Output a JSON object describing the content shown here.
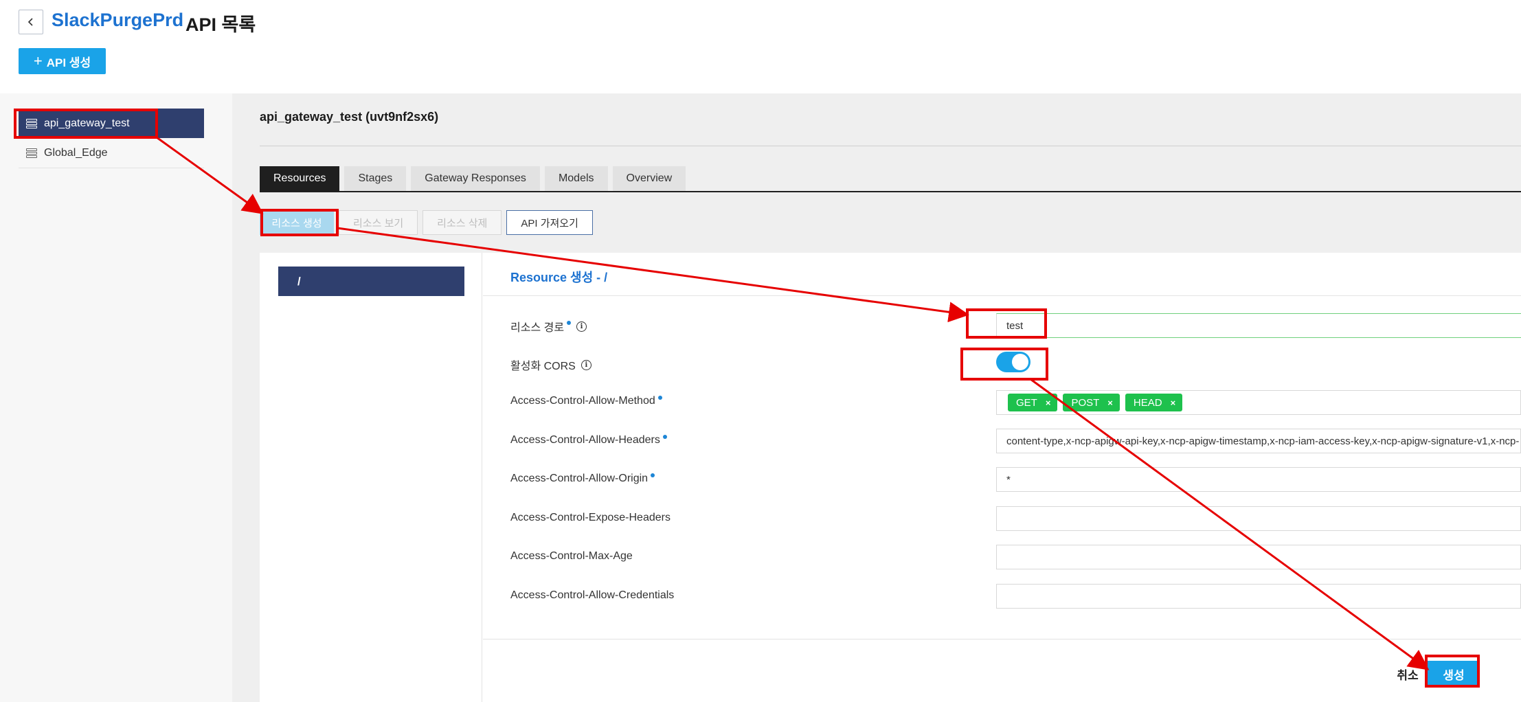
{
  "header": {
    "app_name": "SlackPurgePrd",
    "page_title": "API 목록",
    "create_api_label": "API 생성"
  },
  "sidebar": {
    "items": [
      {
        "label": "api_gateway_test"
      },
      {
        "label": "Global_Edge"
      }
    ]
  },
  "main": {
    "api_heading": "api_gateway_test (uvt9nf2sx6)",
    "tabs": [
      {
        "label": "Resources"
      },
      {
        "label": "Stages"
      },
      {
        "label": "Gateway Responses"
      },
      {
        "label": "Models"
      },
      {
        "label": "Overview"
      }
    ],
    "actions": {
      "create_resource": "리소스 생성",
      "view_resource": "리소스 보기",
      "delete_resource": "리소스 삭제",
      "import_api": "API 가져오기"
    },
    "tree_root": "/",
    "form": {
      "title": "Resource 생성 - /",
      "resource_path_label": "리소스 경로",
      "resource_path_value": "test",
      "cors_label": "활성화 CORS",
      "cors_enabled": true,
      "allow_method_label": "Access-Control-Allow-Method",
      "allow_methods": [
        "GET",
        "POST",
        "HEAD"
      ],
      "allow_headers_label": "Access-Control-Allow-Headers",
      "allow_headers_value": "content-type,x-ncp-apigw-api-key,x-ncp-apigw-timestamp,x-ncp-iam-access-key,x-ncp-apigw-signature-v1,x-ncp-",
      "allow_origin_label": "Access-Control-Allow-Origin",
      "allow_origin_value": "*",
      "expose_headers_label": "Access-Control-Expose-Headers",
      "max_age_label": "Access-Control-Max-Age",
      "allow_credentials_label": "Access-Control-Allow-Credentials",
      "cancel_label": "취소",
      "create_label": "생성"
    }
  },
  "colors": {
    "brand_blue": "#1d72d0",
    "action_blue": "#1aa3e8",
    "nav_dark": "#2f3f6e",
    "chip_green": "#1ec14d",
    "annotation_red": "#e60000"
  }
}
